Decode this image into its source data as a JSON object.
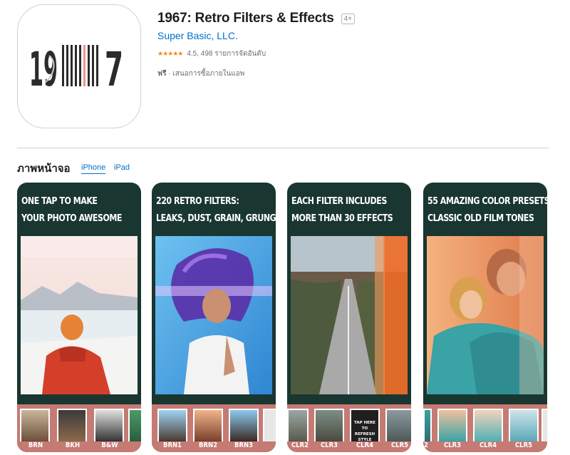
{
  "app": {
    "title": "1967: Retro Filters & Effects",
    "age_rating": "4+",
    "developer": "Super Basic, LLC.",
    "stars": "★★★★★",
    "rating_text": "4.5, 498 รายการจัดอันดับ",
    "price": "ฟรี",
    "price_note": " · เสนอการซื้อภายในแอพ",
    "icon_text": {
      "left": "19",
      "right": "7"
    }
  },
  "screenshots": {
    "heading": "ภาพหน้าจอ",
    "tabs": [
      "iPhone",
      "iPad"
    ],
    "active_tab": "iPhone",
    "items": [
      {
        "caption_line1": "ONE TAP TO MAKE",
        "caption_line2": "YOUR PHOTO AWESOME",
        "thumbs": [
          "BRN",
          "BKH",
          "B&W"
        ]
      },
      {
        "caption_line1": "220 RETRO FILTERS:",
        "caption_line2": "LEAKS, DUST, GRAIN, GRUNGE",
        "thumbs": [
          "BRN1",
          "BRN2",
          "BRN3"
        ]
      },
      {
        "caption_line1": "EACH FILTER INCLUDES",
        "caption_line2": "MORE THAN 30 EFFECTS",
        "thumbs": [
          "CLR2",
          "CLR3",
          "CLR4",
          "CLR5"
        ],
        "tap_hint": "TAP HERE TO REFRESH STYLE"
      },
      {
        "caption_line1": "55 AMAZING COLOR PRESETS:",
        "caption_line2": "CLASSIC OLD FILM TONES",
        "thumbs": [
          "2",
          "CLR3",
          "CLR4",
          "CLR5"
        ]
      }
    ]
  },
  "colors": {
    "link_blue": "#0070c9",
    "star_orange": "#f08a24",
    "card_dark_green": "#193630",
    "strip_pink": "#c57a73"
  }
}
